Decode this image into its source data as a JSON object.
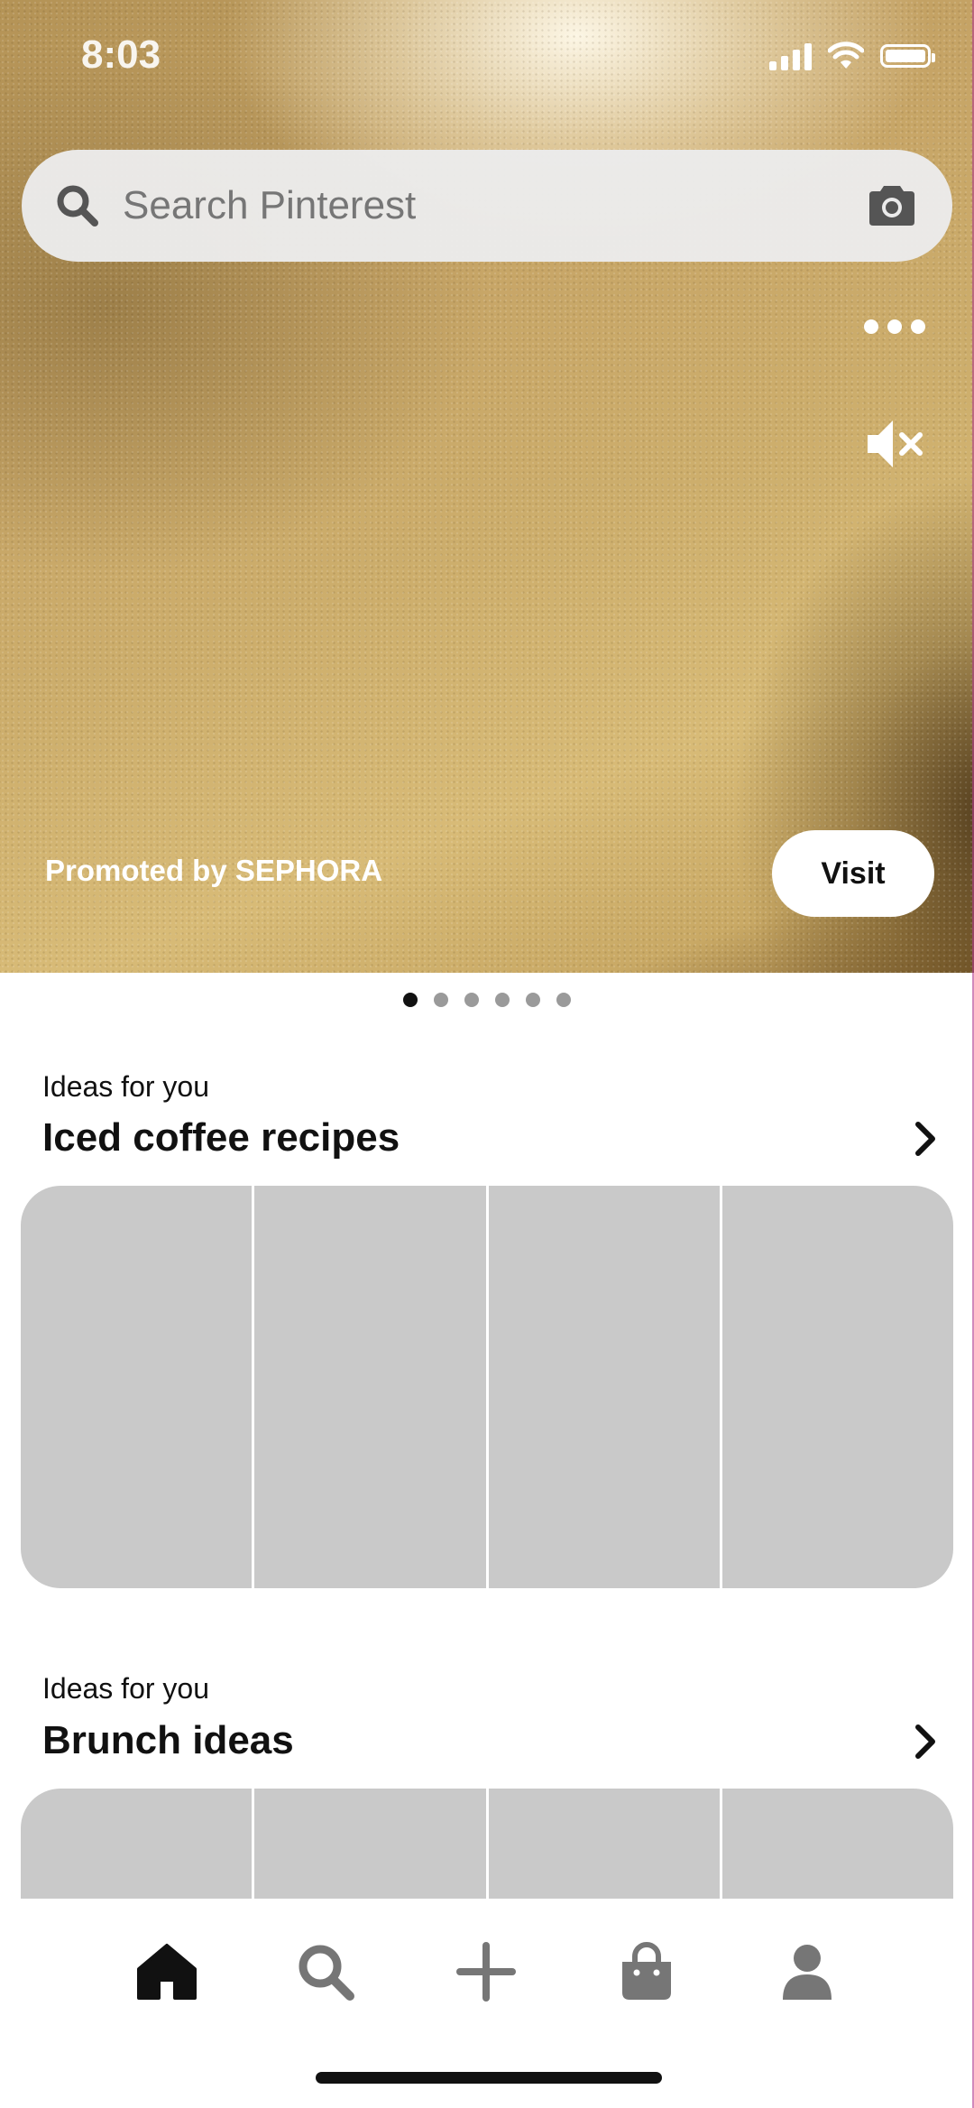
{
  "status_bar": {
    "time": "8:03"
  },
  "search": {
    "placeholder": "Search Pinterest",
    "search_icon": "search-icon",
    "camera_icon": "camera-icon"
  },
  "hero": {
    "promoted_text": "Promoted by SEPHORA",
    "visit_label": "Visit",
    "more_icon": "more-options-icon",
    "mute_icon": "muted-speaker-icon",
    "carousel_dots": 6,
    "carousel_active_index": 0
  },
  "sections": [
    {
      "subtitle": "Ideas for you",
      "title": "Iced coffee recipes",
      "tile_count": 4
    },
    {
      "subtitle": "Ideas for you",
      "title": "Brunch ideas",
      "tile_count": 4
    }
  ],
  "bottom_nav": {
    "items": [
      {
        "icon": "home-icon",
        "active": true
      },
      {
        "icon": "search-icon",
        "active": false
      },
      {
        "icon": "plus-icon",
        "active": false
      },
      {
        "icon": "shopping-bag-icon",
        "active": false
      },
      {
        "icon": "profile-icon",
        "active": false
      }
    ]
  },
  "colors": {
    "tile_placeholder": "#c9c9c9",
    "nav_active": "#111111",
    "nav_inactive": "#767676"
  }
}
